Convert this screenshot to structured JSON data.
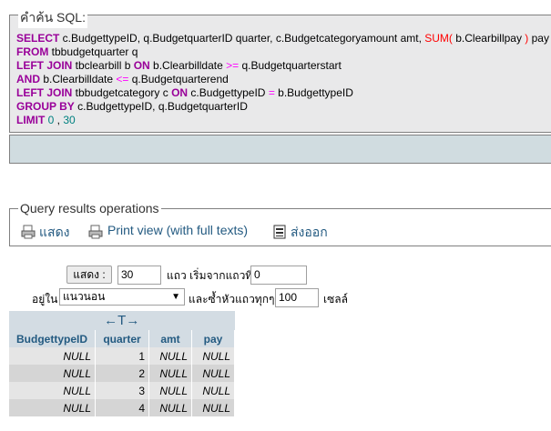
{
  "sql_box": {
    "legend": "คำค้น SQL:",
    "lines": [
      [
        {
          "t": "SELECT",
          "c": "kw"
        },
        {
          "t": " c.BudgettypeID, q.BudgetquarterID quarter, c.Budgetcategoryamount amt, ",
          "c": "id"
        },
        {
          "t": "SUM(",
          "c": "fn"
        },
        {
          "t": " b.Clearbillpay ",
          "c": "id"
        },
        {
          "t": ")",
          "c": "fn"
        },
        {
          "t": " pay",
          "c": "id"
        }
      ],
      [
        {
          "t": "FROM",
          "c": "kw"
        },
        {
          "t": " tbbudgetquarter q",
          "c": "id"
        }
      ],
      [
        {
          "t": "LEFT JOIN",
          "c": "kw"
        },
        {
          "t": " tbclearbill b ",
          "c": "id"
        },
        {
          "t": "ON",
          "c": "kw"
        },
        {
          "t": " b.Clearbilldate ",
          "c": "id"
        },
        {
          "t": ">=",
          "c": "op"
        },
        {
          "t": " q.Budgetquarterstart",
          "c": "id"
        }
      ],
      [
        {
          "t": "AND",
          "c": "kw"
        },
        {
          "t": " b.Clearbilldate ",
          "c": "id"
        },
        {
          "t": "<=",
          "c": "op"
        },
        {
          "t": " q.Budgetquarterend",
          "c": "id"
        }
      ],
      [
        {
          "t": "LEFT JOIN",
          "c": "kw"
        },
        {
          "t": " tbbudgetcategory c ",
          "c": "id"
        },
        {
          "t": "ON",
          "c": "kw"
        },
        {
          "t": " c.BudgettypeID ",
          "c": "id"
        },
        {
          "t": "=",
          "c": "op"
        },
        {
          "t": " b.BudgettypeID",
          "c": "id"
        }
      ],
      [
        {
          "t": "GROUP BY",
          "c": "kw"
        },
        {
          "t": " c.BudgettypeID, q.BudgetquarterID",
          "c": "id"
        }
      ],
      [
        {
          "t": "LIMIT",
          "c": "kw"
        },
        {
          "t": " 0 ",
          "c": "num"
        },
        {
          "t": ",",
          "c": "id"
        },
        {
          "t": " 30",
          "c": "num"
        }
      ]
    ]
  },
  "ops": {
    "legend": "Query results operations",
    "show_label": "แสดง",
    "print_label": "Print view (with full texts)",
    "export_label": "ส่งออก"
  },
  "nav": {
    "show_button": "แสดง :",
    "rows_value": "30",
    "rows_text": "แถว เริ่มจากแถวที่",
    "start_value": "0",
    "in_text": "อยู่ใน",
    "mode_value": "แนวนอน",
    "repeat_text": "และซ้ำหัวแถวทุกๆ",
    "repeat_value": "100",
    "cells_text": "เซลล์"
  },
  "table": {
    "columns": [
      "BudgettypeID",
      "quarter",
      "amt",
      "pay"
    ],
    "rows": [
      [
        "NULL",
        "1",
        "NULL",
        "NULL"
      ],
      [
        "NULL",
        "2",
        "NULL",
        "NULL"
      ],
      [
        "NULL",
        "3",
        "NULL",
        "NULL"
      ],
      [
        "NULL",
        "4",
        "NULL",
        "NULL"
      ]
    ]
  },
  "colors": {
    "link": "#235a81",
    "keyword": "#990099",
    "function": "#ff0000",
    "operator": "#ff00ff",
    "number": "#008080",
    "table_header_bg": "#d3dce3"
  }
}
